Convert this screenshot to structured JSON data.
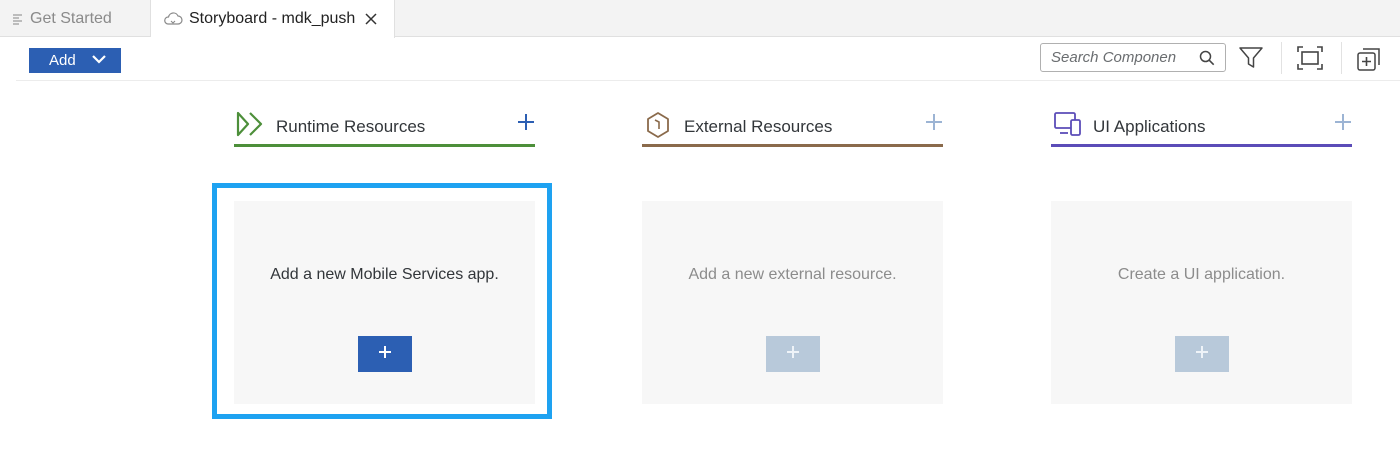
{
  "tabs": [
    {
      "label": "Get Started",
      "active": false,
      "icon": "lines-icon"
    },
    {
      "label": "Storyboard - mdk_push",
      "active": true,
      "icon": "cloud-icon"
    }
  ],
  "toolbar": {
    "add_label": "Add",
    "search_placeholder": "Search Componen",
    "icons": [
      "search-icon",
      "filter-icon",
      "fit-to-screen-icon",
      "add-window-icon"
    ]
  },
  "columns": [
    {
      "title": "Runtime Resources",
      "accent": "#4d8f3a",
      "icon": "runtime-resources-icon",
      "card_text": "Add a new Mobile Services app.",
      "enabled": true
    },
    {
      "title": "External Resources",
      "accent": "#8a6a4b",
      "icon": "external-resources-icon",
      "card_text": "Add a new external resource.",
      "enabled": false
    },
    {
      "title": "UI Applications",
      "accent": "#5b4cb8",
      "icon": "ui-applications-icon",
      "card_text": "Create a UI application.",
      "enabled": false
    }
  ],
  "colors": {
    "primary": "#2c5fb3",
    "highlight": "#1ea2f1",
    "disabled_button": "#b8c9da"
  }
}
